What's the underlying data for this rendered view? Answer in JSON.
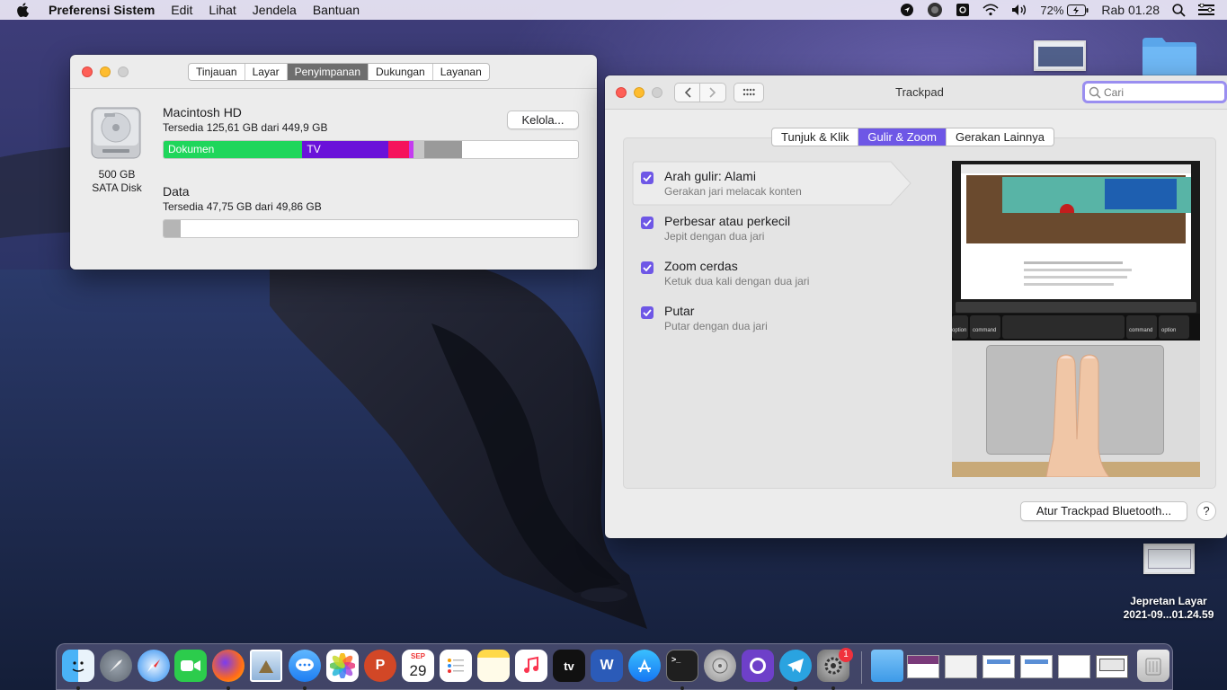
{
  "menubar": {
    "app_name": "Preferensi Sistem",
    "items": [
      "Edit",
      "Lihat",
      "Jendela",
      "Bantuan"
    ],
    "battery": "72%",
    "clock": "Rab 01.28"
  },
  "desktop": {
    "screenshot_label_line1": "Jepretan Layar",
    "screenshot_label_line2": "2021-09...01.24.59"
  },
  "storage_window": {
    "tabs": [
      "Tinjauan",
      "Layar",
      "Penyimpanan",
      "Dukungan",
      "Layanan"
    ],
    "active_tab": "Penyimpanan",
    "disk_size": "500 GB",
    "disk_type": "SATA Disk",
    "volume1": {
      "name": "Macintosh HD",
      "available": "Tersedia 125,61 GB dari 449,9 GB",
      "manage_button": "Kelola...",
      "segments": [
        {
          "label": "Dokumen",
          "fraction": 0.335,
          "color": "#1fd65b"
        },
        {
          "label": "TV",
          "fraction": 0.207,
          "color": "#6a12d9"
        },
        {
          "label": "",
          "fraction": 0.05,
          "color": "#f5135c"
        },
        {
          "label": "",
          "fraction": 0.006,
          "color": "#c43cf0"
        },
        {
          "label": "",
          "fraction": 0.026,
          "color": "#c7c7c7"
        },
        {
          "label": "",
          "fraction": 0.091,
          "color": "#9a9a9a"
        }
      ]
    },
    "volume2": {
      "name": "Data",
      "available": "Tersedia 47,75 GB dari 49,86 GB",
      "used_fraction": 0.042
    }
  },
  "trackpad_window": {
    "title": "Trackpad",
    "search_placeholder": "Cari",
    "tabs": [
      "Tunjuk & Klik",
      "Gulir & Zoom",
      "Gerakan Lainnya"
    ],
    "active_tab": "Gulir & Zoom",
    "options": [
      {
        "title": "Arah gulir: Alami",
        "subtitle": "Gerakan jari melacak konten",
        "checked": true
      },
      {
        "title": "Perbesar atau perkecil",
        "subtitle": "Jepit dengan dua jari",
        "checked": true
      },
      {
        "title": "Zoom cerdas",
        "subtitle": "Ketuk dua kali dengan dua jari",
        "checked": true
      },
      {
        "title": "Putar",
        "subtitle": "Putar dengan dua jari",
        "checked": true
      }
    ],
    "preview_keys": {
      "key1": "option",
      "key2": "command",
      "key3": "command",
      "key4": "option"
    },
    "bluetooth_button": "Atur Trackpad Bluetooth...",
    "help_button": "?"
  },
  "dock": {
    "calendar_month": "SEP",
    "calendar_day": "29",
    "appletv_label": "tv",
    "settings_badge": "1",
    "apps": [
      "finder",
      "launchpad",
      "safari",
      "facetime",
      "firefox",
      "preview",
      "messages",
      "photos",
      "powerpoint",
      "calendar",
      "reminders",
      "notes",
      "music",
      "tv",
      "word",
      "app-store",
      "terminal",
      "disk-utility",
      "github",
      "telegram",
      "system-preferences",
      "downloads-folder",
      "trash"
    ]
  }
}
